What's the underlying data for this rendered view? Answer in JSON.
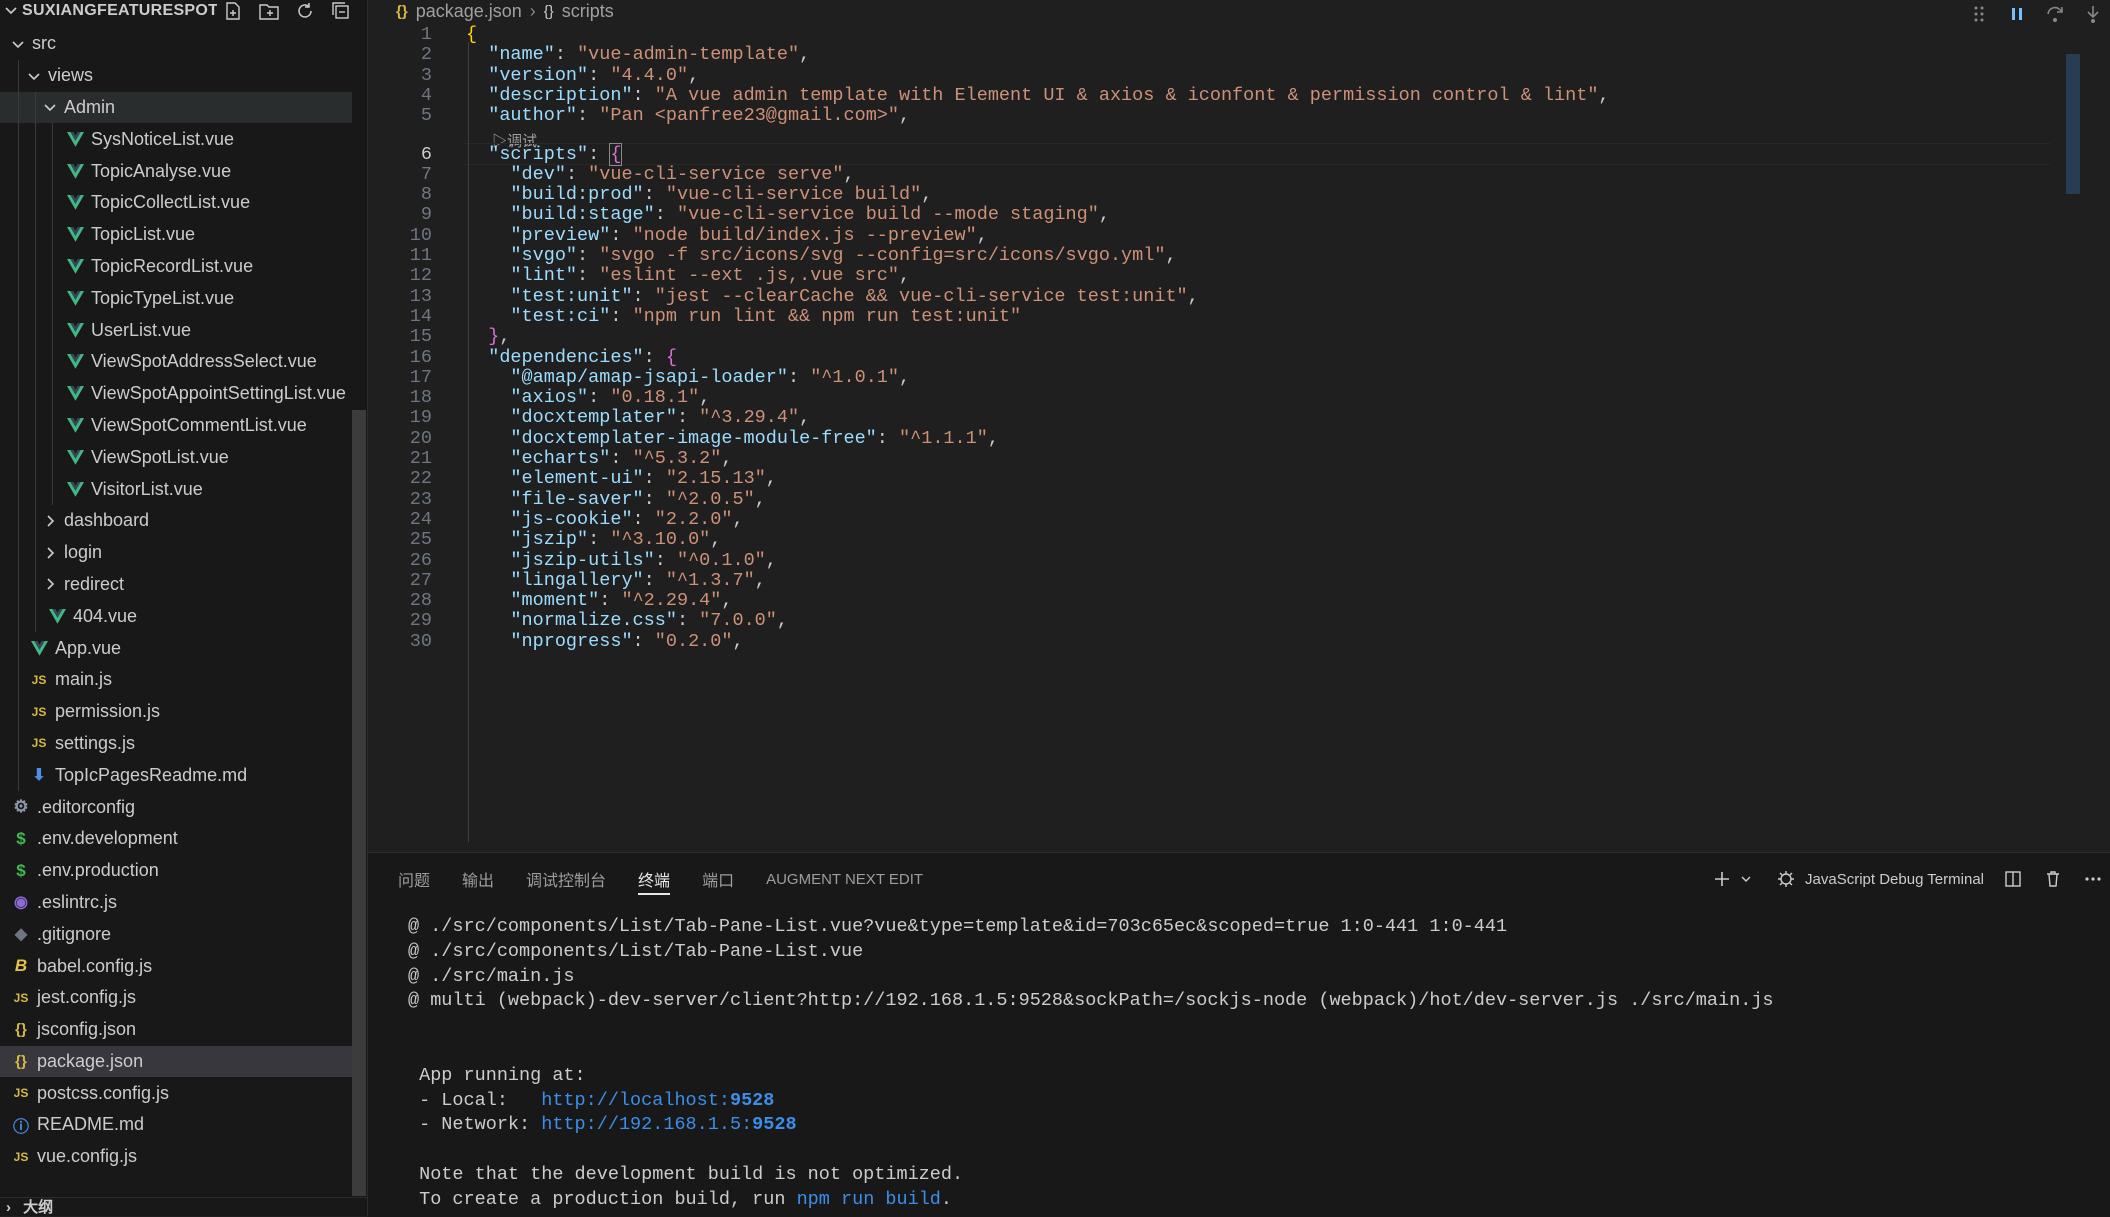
{
  "sidebar": {
    "project_title": "SUXIANGFEATURESPOT...",
    "items": [
      {
        "label": "src",
        "kind": "folder",
        "open": true,
        "depth": 0
      },
      {
        "label": "views",
        "kind": "folder",
        "open": true,
        "depth": 1
      },
      {
        "label": "Admin",
        "kind": "folder",
        "open": true,
        "depth": 2,
        "hover": true
      },
      {
        "label": "SysNoticeList.vue",
        "kind": "vue",
        "depth": 3
      },
      {
        "label": "TopicAnalyse.vue",
        "kind": "vue",
        "depth": 3
      },
      {
        "label": "TopicCollectList.vue",
        "kind": "vue",
        "depth": 3
      },
      {
        "label": "TopicList.vue",
        "kind": "vue",
        "depth": 3
      },
      {
        "label": "TopicRecordList.vue",
        "kind": "vue",
        "depth": 3
      },
      {
        "label": "TopicTypeList.vue",
        "kind": "vue",
        "depth": 3
      },
      {
        "label": "UserList.vue",
        "kind": "vue",
        "depth": 3
      },
      {
        "label": "ViewSpotAddressSelect.vue",
        "kind": "vue",
        "depth": 3
      },
      {
        "label": "ViewSpotAppointSettingList.vue",
        "kind": "vue",
        "depth": 3
      },
      {
        "label": "ViewSpotCommentList.vue",
        "kind": "vue",
        "depth": 3
      },
      {
        "label": "ViewSpotList.vue",
        "kind": "vue",
        "depth": 3
      },
      {
        "label": "VisitorList.vue",
        "kind": "vue",
        "depth": 3
      },
      {
        "label": "dashboard",
        "kind": "folder",
        "open": false,
        "depth": 2
      },
      {
        "label": "login",
        "kind": "folder",
        "open": false,
        "depth": 2
      },
      {
        "label": "redirect",
        "kind": "folder",
        "open": false,
        "depth": 2
      },
      {
        "label": "404.vue",
        "kind": "vue",
        "depth": 2
      },
      {
        "label": "App.vue",
        "kind": "vue",
        "depth": 1
      },
      {
        "label": "main.js",
        "kind": "js",
        "depth": 1
      },
      {
        "label": "permission.js",
        "kind": "js",
        "depth": 1
      },
      {
        "label": "settings.js",
        "kind": "js",
        "depth": 1
      },
      {
        "label": "TopIcPagesReadme.md",
        "kind": "md",
        "depth": 1
      },
      {
        "label": ".editorconfig",
        "kind": "cfg",
        "depth": 0
      },
      {
        "label": ".env.development",
        "kind": "env",
        "depth": 0
      },
      {
        "label": ".env.production",
        "kind": "env",
        "depth": 0
      },
      {
        "label": ".eslintrc.js",
        "kind": "eslint",
        "depth": 0
      },
      {
        "label": ".gitignore",
        "kind": "git",
        "depth": 0
      },
      {
        "label": "babel.config.js",
        "kind": "babel",
        "depth": 0
      },
      {
        "label": "jest.config.js",
        "kind": "js",
        "depth": 0
      },
      {
        "label": "jsconfig.json",
        "kind": "json",
        "depth": 0
      },
      {
        "label": "package.json",
        "kind": "json",
        "depth": 0,
        "selected": true
      },
      {
        "label": "postcss.config.js",
        "kind": "js",
        "depth": 0
      },
      {
        "label": "README.md",
        "kind": "info",
        "depth": 0
      },
      {
        "label": "vue.config.js",
        "kind": "js",
        "depth": 0
      }
    ],
    "outline_label": "大纲"
  },
  "breadcrumb": {
    "file": "package.json",
    "symbol": "scripts"
  },
  "editor": {
    "current_line": 6,
    "codelens_text": "调试",
    "lines": [
      [
        {
          "t": "{",
          "c": "b1"
        }
      ],
      [
        {
          "t": "  "
        },
        {
          "t": "\"name\"",
          "c": "k"
        },
        {
          "t": ": "
        },
        {
          "t": "\"vue-admin-template\"",
          "c": "s"
        },
        {
          "t": ","
        }
      ],
      [
        {
          "t": "  "
        },
        {
          "t": "\"version\"",
          "c": "k"
        },
        {
          "t": ": "
        },
        {
          "t": "\"4.4.0\"",
          "c": "s"
        },
        {
          "t": ","
        }
      ],
      [
        {
          "t": "  "
        },
        {
          "t": "\"description\"",
          "c": "k"
        },
        {
          "t": ": "
        },
        {
          "t": "\"A vue admin template with Element UI & axios & iconfont & permission control & lint\"",
          "c": "s"
        },
        {
          "t": ","
        }
      ],
      [
        {
          "t": "  "
        },
        {
          "t": "\"author\"",
          "c": "k"
        },
        {
          "t": ": "
        },
        {
          "t": "\"Pan <panfree23@gmail.com>\"",
          "c": "s"
        },
        {
          "t": ","
        }
      ],
      [
        {
          "t": "  "
        },
        {
          "t": "\"scripts\"",
          "c": "k"
        },
        {
          "t": ": "
        },
        {
          "t": "{",
          "c": "b2"
        }
      ],
      [
        {
          "t": "    "
        },
        {
          "t": "\"dev\"",
          "c": "k"
        },
        {
          "t": ": "
        },
        {
          "t": "\"vue-cli-service serve\"",
          "c": "s"
        },
        {
          "t": ","
        }
      ],
      [
        {
          "t": "    "
        },
        {
          "t": "\"build:prod\"",
          "c": "k"
        },
        {
          "t": ": "
        },
        {
          "t": "\"vue-cli-service build\"",
          "c": "s"
        },
        {
          "t": ","
        }
      ],
      [
        {
          "t": "    "
        },
        {
          "t": "\"build:stage\"",
          "c": "k"
        },
        {
          "t": ": "
        },
        {
          "t": "\"vue-cli-service build --mode staging\"",
          "c": "s"
        },
        {
          "t": ","
        }
      ],
      [
        {
          "t": "    "
        },
        {
          "t": "\"preview\"",
          "c": "k"
        },
        {
          "t": ": "
        },
        {
          "t": "\"node build/index.js --preview\"",
          "c": "s"
        },
        {
          "t": ","
        }
      ],
      [
        {
          "t": "    "
        },
        {
          "t": "\"svgo\"",
          "c": "k"
        },
        {
          "t": ": "
        },
        {
          "t": "\"svgo -f src/icons/svg --config=src/icons/svgo.yml\"",
          "c": "s"
        },
        {
          "t": ","
        }
      ],
      [
        {
          "t": "    "
        },
        {
          "t": "\"lint\"",
          "c": "k"
        },
        {
          "t": ": "
        },
        {
          "t": "\"eslint --ext .js,.vue src\"",
          "c": "s"
        },
        {
          "t": ","
        }
      ],
      [
        {
          "t": "    "
        },
        {
          "t": "\"test:unit\"",
          "c": "k"
        },
        {
          "t": ": "
        },
        {
          "t": "\"jest --clearCache && vue-cli-service test:unit\"",
          "c": "s"
        },
        {
          "t": ","
        }
      ],
      [
        {
          "t": "    "
        },
        {
          "t": "\"test:ci\"",
          "c": "k"
        },
        {
          "t": ": "
        },
        {
          "t": "\"npm run lint && npm run test:unit\"",
          "c": "s"
        }
      ],
      [
        {
          "t": "  "
        },
        {
          "t": "}",
          "c": "b2"
        },
        {
          "t": ","
        }
      ],
      [
        {
          "t": "  "
        },
        {
          "t": "\"dependencies\"",
          "c": "k"
        },
        {
          "t": ": "
        },
        {
          "t": "{",
          "c": "b2"
        }
      ],
      [
        {
          "t": "    "
        },
        {
          "t": "\"@amap/amap-jsapi-loader\"",
          "c": "k"
        },
        {
          "t": ": "
        },
        {
          "t": "\"^1.0.1\"",
          "c": "s"
        },
        {
          "t": ","
        }
      ],
      [
        {
          "t": "    "
        },
        {
          "t": "\"axios\"",
          "c": "k"
        },
        {
          "t": ": "
        },
        {
          "t": "\"0.18.1\"",
          "c": "s"
        },
        {
          "t": ","
        }
      ],
      [
        {
          "t": "    "
        },
        {
          "t": "\"docxtemplater\"",
          "c": "k"
        },
        {
          "t": ": "
        },
        {
          "t": "\"^3.29.4\"",
          "c": "s"
        },
        {
          "t": ","
        }
      ],
      [
        {
          "t": "    "
        },
        {
          "t": "\"docxtemplater-image-module-free\"",
          "c": "k"
        },
        {
          "t": ": "
        },
        {
          "t": "\"^1.1.1\"",
          "c": "s"
        },
        {
          "t": ","
        }
      ],
      [
        {
          "t": "    "
        },
        {
          "t": "\"echarts\"",
          "c": "k"
        },
        {
          "t": ": "
        },
        {
          "t": "\"^5.3.2\"",
          "c": "s"
        },
        {
          "t": ","
        }
      ],
      [
        {
          "t": "    "
        },
        {
          "t": "\"element-ui\"",
          "c": "k"
        },
        {
          "t": ": "
        },
        {
          "t": "\"2.15.13\"",
          "c": "s"
        },
        {
          "t": ","
        }
      ],
      [
        {
          "t": "    "
        },
        {
          "t": "\"file-saver\"",
          "c": "k"
        },
        {
          "t": ": "
        },
        {
          "t": "\"^2.0.5\"",
          "c": "s"
        },
        {
          "t": ","
        }
      ],
      [
        {
          "t": "    "
        },
        {
          "t": "\"js-cookie\"",
          "c": "k"
        },
        {
          "t": ": "
        },
        {
          "t": "\"2.2.0\"",
          "c": "s"
        },
        {
          "t": ","
        }
      ],
      [
        {
          "t": "    "
        },
        {
          "t": "\"jszip\"",
          "c": "k"
        },
        {
          "t": ": "
        },
        {
          "t": "\"^3.10.0\"",
          "c": "s"
        },
        {
          "t": ","
        }
      ],
      [
        {
          "t": "    "
        },
        {
          "t": "\"jszip-utils\"",
          "c": "k"
        },
        {
          "t": ": "
        },
        {
          "t": "\"^0.1.0\"",
          "c": "s"
        },
        {
          "t": ","
        }
      ],
      [
        {
          "t": "    "
        },
        {
          "t": "\"lingallery\"",
          "c": "k"
        },
        {
          "t": ": "
        },
        {
          "t": "\"^1.3.7\"",
          "c": "s"
        },
        {
          "t": ","
        }
      ],
      [
        {
          "t": "    "
        },
        {
          "t": "\"moment\"",
          "c": "k"
        },
        {
          "t": ": "
        },
        {
          "t": "\"^2.29.4\"",
          "c": "s"
        },
        {
          "t": ","
        }
      ],
      [
        {
          "t": "    "
        },
        {
          "t": "\"normalize.css\"",
          "c": "k"
        },
        {
          "t": ": "
        },
        {
          "t": "\"7.0.0\"",
          "c": "s"
        },
        {
          "t": ","
        }
      ],
      [
        {
          "t": "    "
        },
        {
          "t": "\"nprogress\"",
          "c": "k"
        },
        {
          "t": ": "
        },
        {
          "t": "\"0.2.0\"",
          "c": "s"
        },
        {
          "t": ","
        }
      ]
    ]
  },
  "panel": {
    "tabs": [
      {
        "label": "问题",
        "active": false
      },
      {
        "label": "输出",
        "active": false
      },
      {
        "label": "调试控制台",
        "active": false
      },
      {
        "label": "终端",
        "active": true
      },
      {
        "label": "端口",
        "active": false
      },
      {
        "label": "AUGMENT NEXT EDIT",
        "active": false
      }
    ],
    "terminal_name": "JavaScript Debug Terminal",
    "terminal_lines": [
      [
        {
          "t": "@ ./src/components/List/Tab-Pane-List.vue?vue&type=template&id=703c65ec&scoped=true 1:0-441 1:0-441"
        }
      ],
      [
        {
          "t": "@ ./src/components/List/Tab-Pane-List.vue"
        }
      ],
      [
        {
          "t": "@ ./src/main.js"
        }
      ],
      [
        {
          "t": "@ multi (webpack)-dev-server/client?http://192.168.1.5:9528&sockPath=/sockjs-node (webpack)/hot/dev-server.js ./src/main.js"
        }
      ],
      [
        {
          "t": ""
        }
      ],
      [
        {
          "t": ""
        }
      ],
      [
        {
          "t": " App running at:"
        }
      ],
      [
        {
          "t": " - Local:   "
        },
        {
          "t": "http://localhost:",
          "c": "lnk"
        },
        {
          "t": "9528",
          "c": "lnk",
          "b": true
        }
      ],
      [
        {
          "t": " - Network: "
        },
        {
          "t": "http://192.168.1.5:",
          "c": "lnk"
        },
        {
          "t": "9528",
          "c": "lnk",
          "b": true
        }
      ],
      [
        {
          "t": ""
        }
      ],
      [
        {
          "t": " Note that the development build is not optimized."
        }
      ],
      [
        {
          "t": " To create a production build, run "
        },
        {
          "t": "npm run build",
          "c": "lnk"
        },
        {
          "t": "."
        }
      ]
    ]
  }
}
